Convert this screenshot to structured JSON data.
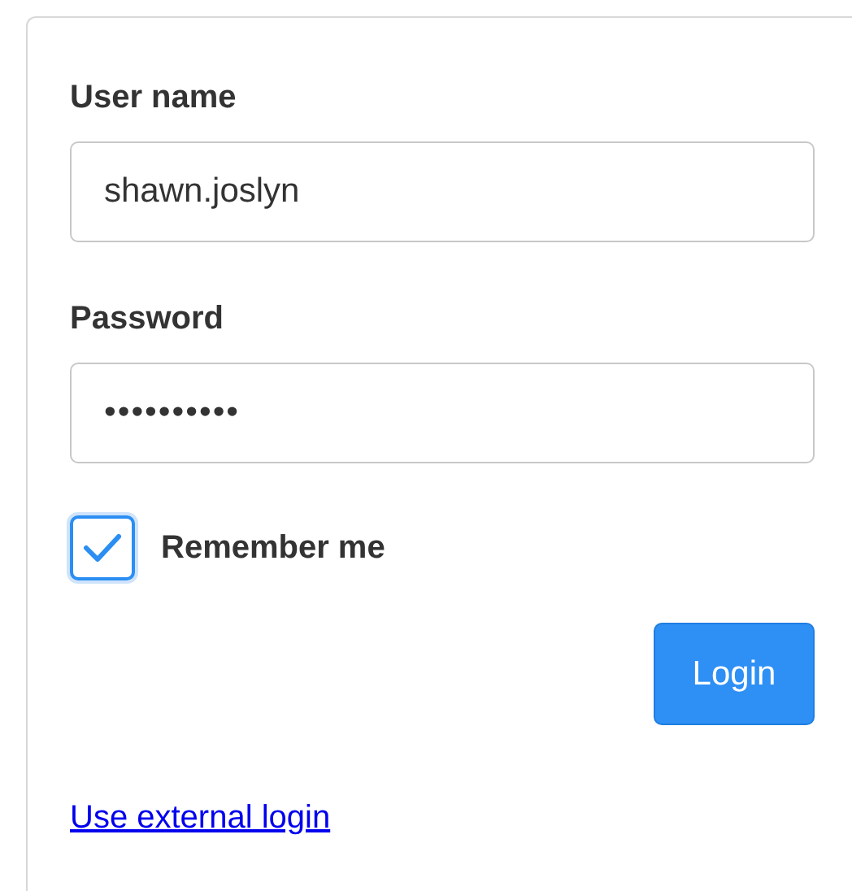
{
  "form": {
    "fields": [
      {
        "label": "User name",
        "value": "shawn.joslyn"
      },
      {
        "label": "Password",
        "value": "••••••••••"
      }
    ],
    "remember": {
      "label": "Remember me",
      "checked": true
    },
    "login_button": "Login",
    "external_link": "Use external login"
  }
}
